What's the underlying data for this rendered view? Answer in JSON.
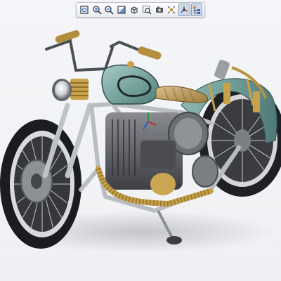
{
  "toolbar": {
    "buttons": [
      {
        "icon": "zoom-fit-icon",
        "active": false
      },
      {
        "icon": "zoom-in-icon",
        "active": false
      },
      {
        "icon": "zoom-out-icon",
        "active": false
      },
      {
        "icon": "shaded-view-icon",
        "active": false
      },
      {
        "icon": "named-views-icon",
        "active": false
      },
      {
        "icon": "zoom-window-icon",
        "active": false
      },
      {
        "icon": "camera-icon",
        "active": false
      },
      {
        "icon": "explode-icon",
        "active": false
      },
      {
        "icon": "spin-center-icon",
        "active": true
      },
      {
        "icon": "model-tree-icon",
        "active": true
      }
    ]
  },
  "model": {
    "subject": "custom-bobber-motorcycle-3d-model",
    "colors": {
      "tank": "#7fa9a5",
      "fender": "#6f9d9a",
      "frame": "#b9bcc0",
      "tire": "#222326",
      "brass": "#c8a24a",
      "engine": "#5b5d62",
      "chrome": "#d6d8dc"
    }
  }
}
